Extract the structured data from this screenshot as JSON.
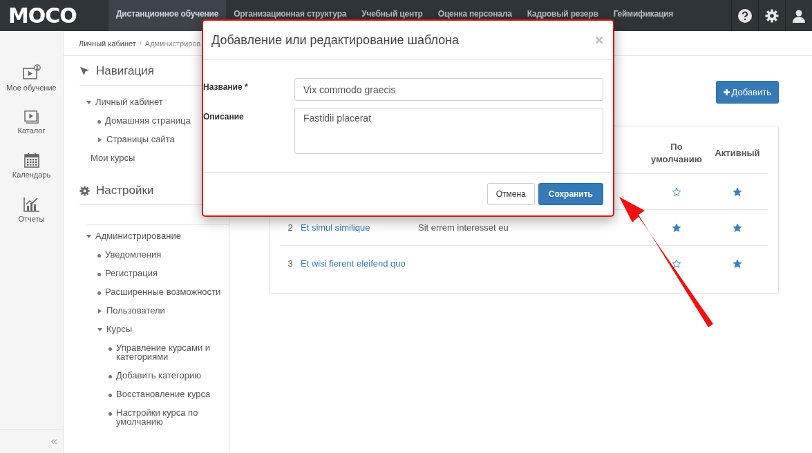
{
  "topbar": {
    "logo": "MOCO",
    "menu": [
      {
        "label": "Дистанционное обучение",
        "selected": true
      },
      {
        "label": "Организационная структура",
        "selected": false
      },
      {
        "label": "Учебный центр",
        "selected": false
      },
      {
        "label": "Оценка персонала",
        "selected": false
      },
      {
        "label": "Кадровый резерв",
        "selected": false
      },
      {
        "label": "Геймификация",
        "selected": false
      }
    ]
  },
  "rail": {
    "items": [
      {
        "label": "Мое обучение",
        "kind": "learning"
      },
      {
        "label": "Каталог",
        "kind": "catalog"
      },
      {
        "label": "Календарь",
        "kind": "calendar"
      },
      {
        "label": "Отчеты",
        "kind": "reports"
      }
    ],
    "collapse": "«"
  },
  "breadcrumb": {
    "separator": "/",
    "items": [
      "Личный кабинет",
      "Администриров"
    ]
  },
  "navigation": {
    "title": "Навигация",
    "items": [
      {
        "label": "Личный кабинет",
        "kind": "branch",
        "expanded": true,
        "children": [
          {
            "label": "Домашняя страница",
            "kind": "leaf"
          },
          {
            "label": "Страницы сайта",
            "kind": "branch",
            "expanded": false
          }
        ]
      },
      {
        "label": "Мои курсы",
        "kind": "plain"
      }
    ]
  },
  "settings": {
    "title": "Настройки",
    "items": [
      {
        "label": "Администрирование",
        "kind": "branch",
        "expanded": true,
        "children": [
          {
            "label": "Уведомления",
            "kind": "leaf"
          },
          {
            "label": "Регистрация",
            "kind": "leaf"
          },
          {
            "label": "Расширенные возможности",
            "kind": "leaf"
          },
          {
            "label": "Пользователи",
            "kind": "branch",
            "expanded": false
          },
          {
            "label": "Курсы",
            "kind": "branch",
            "expanded": true,
            "children": [
              {
                "label": "Управление курсами и категориями",
                "kind": "leaf"
              },
              {
                "label": "Добавить категорию",
                "kind": "leaf"
              },
              {
                "label": "Восстановление курса",
                "kind": "leaf"
              },
              {
                "label": "Настройки курса по умолчанию",
                "kind": "leaf"
              }
            ]
          }
        ]
      }
    ]
  },
  "add_button": "Добавить",
  "table": {
    "columns": [
      "По умолчанию",
      "Активный"
    ],
    "rows": [
      {
        "default": false,
        "active": true
      },
      {
        "number": "2",
        "title": "Et simul similique",
        "description": "Sit errem interesset eu",
        "default": true,
        "active": true
      },
      {
        "number": "3",
        "title": "Et wisi fierent eleifend quo",
        "default": false,
        "active": true
      }
    ]
  },
  "modal": {
    "title": "Добавление или редактирование шаблона",
    "close": "×",
    "fields": [
      {
        "label": "Название *",
        "kind": "input",
        "value": "Vix commodo graecis"
      },
      {
        "label": "Описание",
        "kind": "textarea",
        "value": "Fastidii placerat"
      }
    ],
    "buttons": [
      {
        "label": "Отмена",
        "kind": "default"
      },
      {
        "label": "Сохранить",
        "kind": "primary"
      }
    ]
  }
}
